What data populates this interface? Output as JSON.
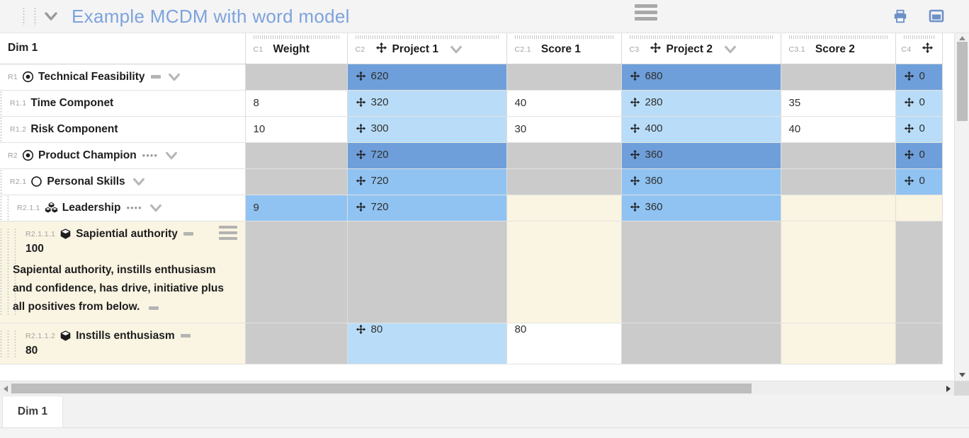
{
  "titlebar": {
    "drag_handle": "drag-handles",
    "chevron": "chevron-down-icon",
    "title": "Example MCDM with word model",
    "menu_icon": "hamburger-menu-icon",
    "print_icon": "print-icon",
    "window_icon": "window-restore-icon",
    "accent_color": "#7da3dd"
  },
  "columns": [
    {
      "id": "",
      "label": "Dim 1",
      "has_move": false,
      "has_chevron": false
    },
    {
      "id": "C1",
      "label": "Weight",
      "has_move": false,
      "has_chevron": false
    },
    {
      "id": "C2",
      "label": "Project 1",
      "has_move": true,
      "has_chevron": true
    },
    {
      "id": "C2.1",
      "label": "Score 1",
      "has_move": false,
      "has_chevron": false
    },
    {
      "id": "C3",
      "label": "Project 2",
      "has_move": true,
      "has_chevron": true
    },
    {
      "id": "C3.1",
      "label": "Score 2",
      "has_move": false,
      "has_chevron": false
    },
    {
      "id": "C4",
      "label": "",
      "has_move": true,
      "has_chevron": false
    }
  ],
  "rows": [
    {
      "kind": "std",
      "id": "R1",
      "icon": "target-icon",
      "label": "Technical Feasibility",
      "indent": 0,
      "suffix": "dash",
      "chevron": true,
      "cells": [
        {
          "value": "",
          "bg": "grey",
          "move": false
        },
        {
          "value": "620",
          "bg": "blue-d",
          "move": true
        },
        {
          "value": "",
          "bg": "grey",
          "move": false
        },
        {
          "value": "680",
          "bg": "blue-d",
          "move": true
        },
        {
          "value": "",
          "bg": "grey",
          "move": false
        },
        {
          "value": "0",
          "bg": "blue-d",
          "move": true
        }
      ]
    },
    {
      "kind": "std",
      "id": "R1.1",
      "icon": "none",
      "label": "Time Componet",
      "indent": 1,
      "suffix": "none",
      "chevron": false,
      "cells": [
        {
          "value": "8",
          "bg": "white",
          "move": false
        },
        {
          "value": "320",
          "bg": "blue-l",
          "move": true
        },
        {
          "value": "40",
          "bg": "white",
          "move": false
        },
        {
          "value": "280",
          "bg": "blue-l",
          "move": true
        },
        {
          "value": "35",
          "bg": "white",
          "move": false
        },
        {
          "value": "0",
          "bg": "blue-l",
          "move": true
        }
      ]
    },
    {
      "kind": "std",
      "id": "R1.2",
      "icon": "none",
      "label": "Risk Component",
      "indent": 1,
      "suffix": "none",
      "chevron": false,
      "cells": [
        {
          "value": "10",
          "bg": "white",
          "move": false
        },
        {
          "value": "300",
          "bg": "blue-l",
          "move": true
        },
        {
          "value": "30",
          "bg": "white",
          "move": false
        },
        {
          "value": "400",
          "bg": "blue-l",
          "move": true
        },
        {
          "value": "40",
          "bg": "white",
          "move": false
        },
        {
          "value": "0",
          "bg": "blue-l",
          "move": true
        }
      ]
    },
    {
      "kind": "std",
      "id": "R2",
      "icon": "target-icon",
      "label": "Product Champion",
      "indent": 0,
      "suffix": "dots",
      "chevron": true,
      "cells": [
        {
          "value": "",
          "bg": "grey",
          "move": false
        },
        {
          "value": "720",
          "bg": "blue-d",
          "move": true
        },
        {
          "value": "",
          "bg": "grey",
          "move": false
        },
        {
          "value": "360",
          "bg": "blue-d",
          "move": true
        },
        {
          "value": "",
          "bg": "grey",
          "move": false
        },
        {
          "value": "0",
          "bg": "blue-d",
          "move": true
        }
      ]
    },
    {
      "kind": "std",
      "id": "R2.1",
      "icon": "circle-icon",
      "label": "Personal Skills",
      "indent": 1,
      "suffix": "none",
      "chevron": true,
      "cells": [
        {
          "value": "",
          "bg": "grey",
          "move": false
        },
        {
          "value": "720",
          "bg": "blue-m",
          "move": true
        },
        {
          "value": "",
          "bg": "grey",
          "move": false
        },
        {
          "value": "360",
          "bg": "blue-m",
          "move": true
        },
        {
          "value": "",
          "bg": "grey",
          "move": false
        },
        {
          "value": "0",
          "bg": "blue-m",
          "move": true
        }
      ]
    },
    {
      "kind": "std",
      "id": "R2.1.1",
      "icon": "cubes-icon",
      "label": "Leadership",
      "indent": 2,
      "suffix": "dots",
      "chevron": true,
      "cells": [
        {
          "value": "9",
          "bg": "blue-m",
          "move": false
        },
        {
          "value": "720",
          "bg": "blue-m",
          "move": true
        },
        {
          "value": "",
          "bg": "cream",
          "move": false
        },
        {
          "value": "360",
          "bg": "blue-m",
          "move": true
        },
        {
          "value": "",
          "bg": "cream",
          "move": false
        },
        {
          "value": "",
          "bg": "cream",
          "move": false
        }
      ]
    },
    {
      "kind": "note",
      "id": "R2.1.1.1",
      "icon": "cube-icon",
      "label": "Sapiential authority",
      "indent": 3,
      "suffix": "dash",
      "number": "100",
      "text": "Sapiental authority, instills enthusiasm and confidence, has drive, initiative plus all positives from below.",
      "text_suffix": "dash",
      "cells": [
        {
          "value": "",
          "bg": "grey",
          "move": false
        },
        {
          "value": "",
          "bg": "grey",
          "move": false
        },
        {
          "value": "",
          "bg": "cream",
          "move": false
        },
        {
          "value": "",
          "bg": "grey",
          "move": false
        },
        {
          "value": "",
          "bg": "cream",
          "move": false
        },
        {
          "value": "",
          "bg": "grey",
          "move": false
        }
      ]
    },
    {
      "kind": "note",
      "id": "R2.1.1.2",
      "icon": "cube-icon",
      "label": "Instills enthusiasm",
      "indent": 3,
      "suffix": "dash",
      "number": "80",
      "text": "",
      "text_suffix": "none",
      "cells": [
        {
          "value": "",
          "bg": "grey",
          "move": false
        },
        {
          "value": "80",
          "bg": "blue-l",
          "move": true
        },
        {
          "value": "80",
          "bg": "white",
          "move": false
        },
        {
          "value": "",
          "bg": "grey",
          "move": false
        },
        {
          "value": "",
          "bg": "cream",
          "move": false
        },
        {
          "value": "",
          "bg": "grey",
          "move": false
        }
      ]
    }
  ],
  "scrollbars": {
    "v_up": "scroll-up-arrow",
    "v_down": "scroll-down-arrow",
    "h_left": "scroll-left-arrow",
    "h_right": "scroll-right-arrow"
  },
  "tabs": [
    {
      "label": "Dim 1",
      "active": true
    }
  ],
  "colors": {
    "blue_dark": "#6e9fda",
    "blue_medium": "#90c3f2",
    "blue_light": "#b9ddf8",
    "grey_cell": "#cbcbcb",
    "cream_cell": "#faf4e2"
  }
}
